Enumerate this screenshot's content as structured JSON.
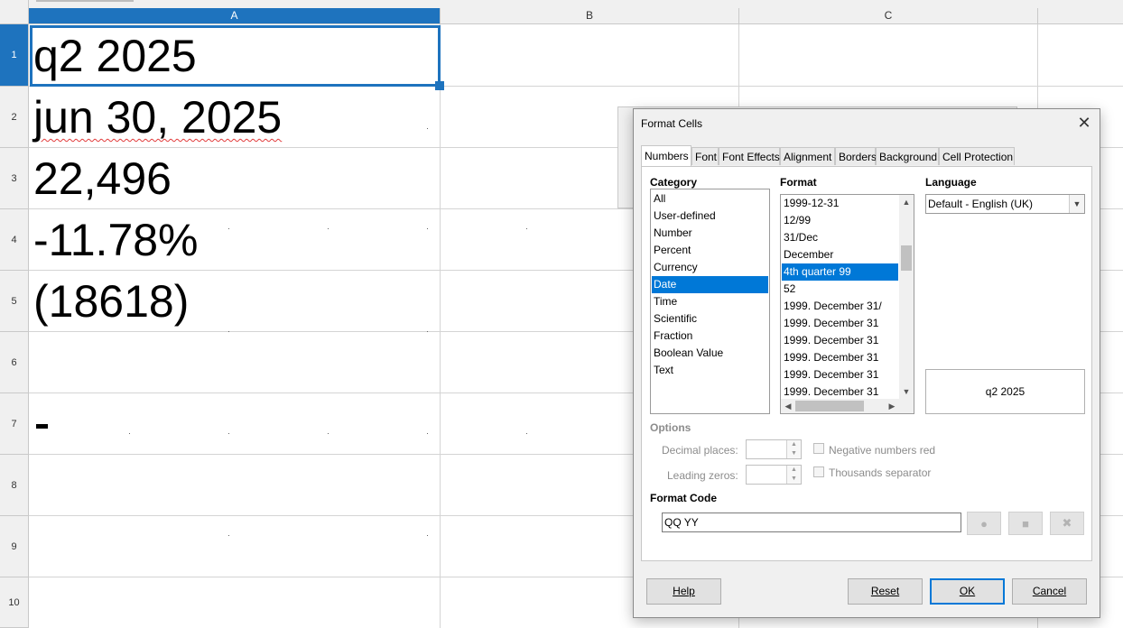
{
  "spreadsheet": {
    "columns": [
      "A",
      "B",
      "C"
    ],
    "rows": [
      "1",
      "2",
      "3",
      "4",
      "5",
      "6",
      "7",
      "8",
      "9",
      "10"
    ],
    "cells": {
      "a1": "q2 2025",
      "a2": "jun 30, 2025",
      "a3": "22,496",
      "a4": "-11.78%",
      "a5": "(18618)"
    },
    "selected_cell": "A1"
  },
  "dialog": {
    "title": "Format Cells",
    "close_glyph": "✕",
    "tabs": [
      "Numbers",
      "Font",
      "Font Effects",
      "Alignment",
      "Borders",
      "Background",
      "Cell Protection"
    ],
    "active_tab": "Numbers",
    "category_label": "Category",
    "categories": [
      "All",
      "User-defined",
      "Number",
      "Percent",
      "Currency",
      "Date",
      "Time",
      "Scientific",
      "Fraction",
      "Boolean Value",
      "Text"
    ],
    "selected_category": "Date",
    "format_label": "Format",
    "formats": [
      "1999-12-31",
      "12/99",
      "31/Dec",
      "December",
      "4th quarter 99",
      "52",
      "1999. December 31/",
      "1999. December 31",
      "1999. December 31",
      "1999. December 31",
      "1999. December 31",
      "1999. December 31"
    ],
    "selected_format": "4th quarter 99",
    "language_label": "Language",
    "language_value": "Default - English (UK)",
    "preview_text": "q2 2025",
    "options_label": "Options",
    "decimal_places_label": "Decimal places:",
    "leading_zeros_label": "Leading zeros:",
    "negative_red_label": "Negative numbers red",
    "thousands_sep_label": "Thousands separator",
    "format_code_label": "Format Code",
    "format_code_value": "QQ YY",
    "buttons": {
      "help": "Help",
      "reset": "Reset",
      "ok": "OK",
      "cancel": "Cancel"
    }
  }
}
